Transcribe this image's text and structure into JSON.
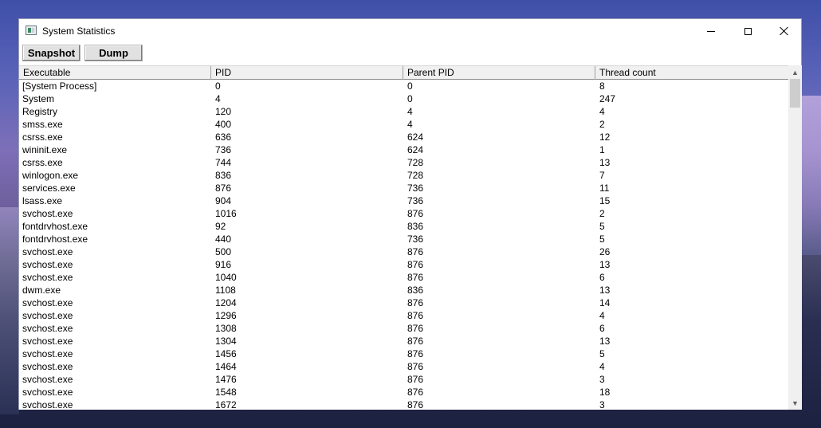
{
  "window": {
    "title": "System Statistics"
  },
  "toolbar": {
    "snapshot_label": "Snapshot",
    "dump_label": "Dump"
  },
  "table": {
    "columns": [
      "Executable",
      "PID",
      "Parent PID",
      "Thread count"
    ],
    "rows": [
      [
        "[System Process]",
        "0",
        "0",
        "8"
      ],
      [
        "System",
        "4",
        "0",
        "247"
      ],
      [
        "Registry",
        "120",
        "4",
        "4"
      ],
      [
        "smss.exe",
        "400",
        "4",
        "2"
      ],
      [
        "csrss.exe",
        "636",
        "624",
        "12"
      ],
      [
        "wininit.exe",
        "736",
        "624",
        "1"
      ],
      [
        "csrss.exe",
        "744",
        "728",
        "13"
      ],
      [
        "winlogon.exe",
        "836",
        "728",
        "7"
      ],
      [
        "services.exe",
        "876",
        "736",
        "11"
      ],
      [
        "lsass.exe",
        "904",
        "736",
        "15"
      ],
      [
        "svchost.exe",
        "1016",
        "876",
        "2"
      ],
      [
        "fontdrvhost.exe",
        "92",
        "836",
        "5"
      ],
      [
        "fontdrvhost.exe",
        "440",
        "736",
        "5"
      ],
      [
        "svchost.exe",
        "500",
        "876",
        "26"
      ],
      [
        "svchost.exe",
        "916",
        "876",
        "13"
      ],
      [
        "svchost.exe",
        "1040",
        "876",
        "6"
      ],
      [
        "dwm.exe",
        "1108",
        "836",
        "13"
      ],
      [
        "svchost.exe",
        "1204",
        "876",
        "14"
      ],
      [
        "svchost.exe",
        "1296",
        "876",
        "4"
      ],
      [
        "svchost.exe",
        "1308",
        "876",
        "6"
      ],
      [
        "svchost.exe",
        "1304",
        "876",
        "13"
      ],
      [
        "svchost.exe",
        "1456",
        "876",
        "5"
      ],
      [
        "svchost.exe",
        "1464",
        "876",
        "4"
      ],
      [
        "svchost.exe",
        "1476",
        "876",
        "3"
      ],
      [
        "svchost.exe",
        "1548",
        "876",
        "18"
      ],
      [
        "svchost.exe",
        "1672",
        "876",
        "3"
      ]
    ]
  },
  "icons": {
    "app": "app-window-icon",
    "minimize": "minimize-icon",
    "maximize": "maximize-icon",
    "close": "close-icon",
    "scroll_up": "chevron-up-icon",
    "scroll_down": "chevron-down-icon"
  }
}
